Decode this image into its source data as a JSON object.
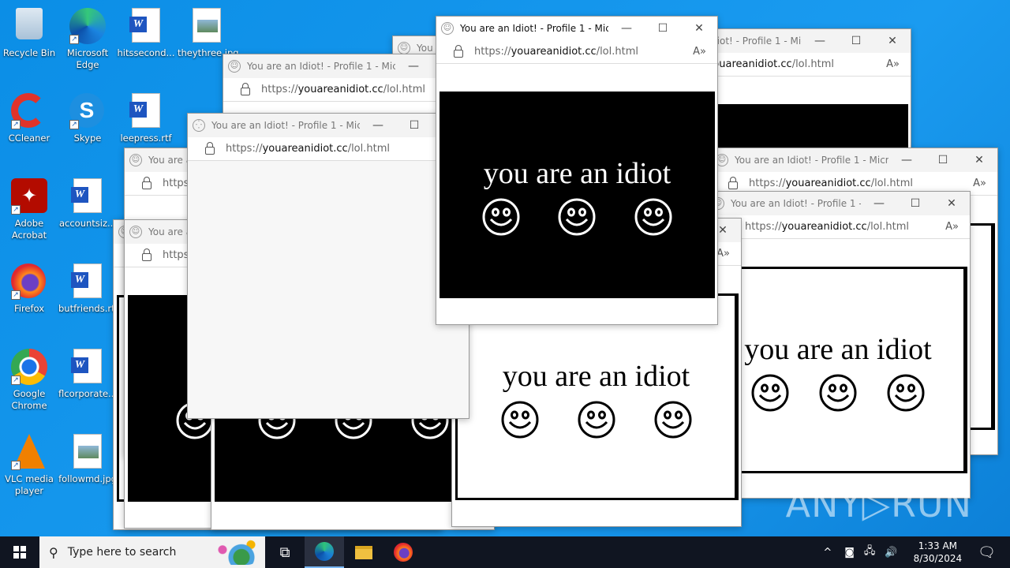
{
  "desktop_icons": [
    {
      "label": "Recycle Bin",
      "icon": "recycle-bin-icon"
    },
    {
      "label": "Microsoft Edge",
      "icon": "edge-icon"
    },
    {
      "label": "hitssecond...",
      "icon": "word-doc-icon"
    },
    {
      "label": "theythree.jpg",
      "icon": "image-file-icon"
    },
    {
      "label": "CCleaner",
      "icon": "ccleaner-icon"
    },
    {
      "label": "Skype",
      "icon": "skype-icon"
    },
    {
      "label": "leepress.rtf",
      "icon": "word-doc-icon"
    },
    {
      "label": "Adobe Acrobat",
      "icon": "acrobat-icon"
    },
    {
      "label": "accountsiz...",
      "icon": "word-doc-icon"
    },
    {
      "label": "Firefox",
      "icon": "firefox-icon"
    },
    {
      "label": "butfriends.rtf",
      "icon": "word-doc-icon"
    },
    {
      "label": "Google Chrome",
      "icon": "chrome-icon"
    },
    {
      "label": "flcorporate...",
      "icon": "word-doc-icon"
    },
    {
      "label": "VLC media player",
      "icon": "vlc-icon"
    },
    {
      "label": "followmd.jpg",
      "icon": "image-file-icon"
    }
  ],
  "browser": {
    "window_title": "You are an Idiot! - Profile 1 - Micro...",
    "url_scheme": "https://",
    "url_domain": "youareanidiot.cc",
    "url_path": "/lol.html",
    "page_text": "you are an idiot",
    "minimize": "—",
    "maximize": "☐",
    "close": "✕"
  },
  "taskbar": {
    "search_placeholder": "Type here to search",
    "time": "1:33 AM",
    "date": "8/30/2024"
  },
  "watermark": "ANY▷RUN"
}
